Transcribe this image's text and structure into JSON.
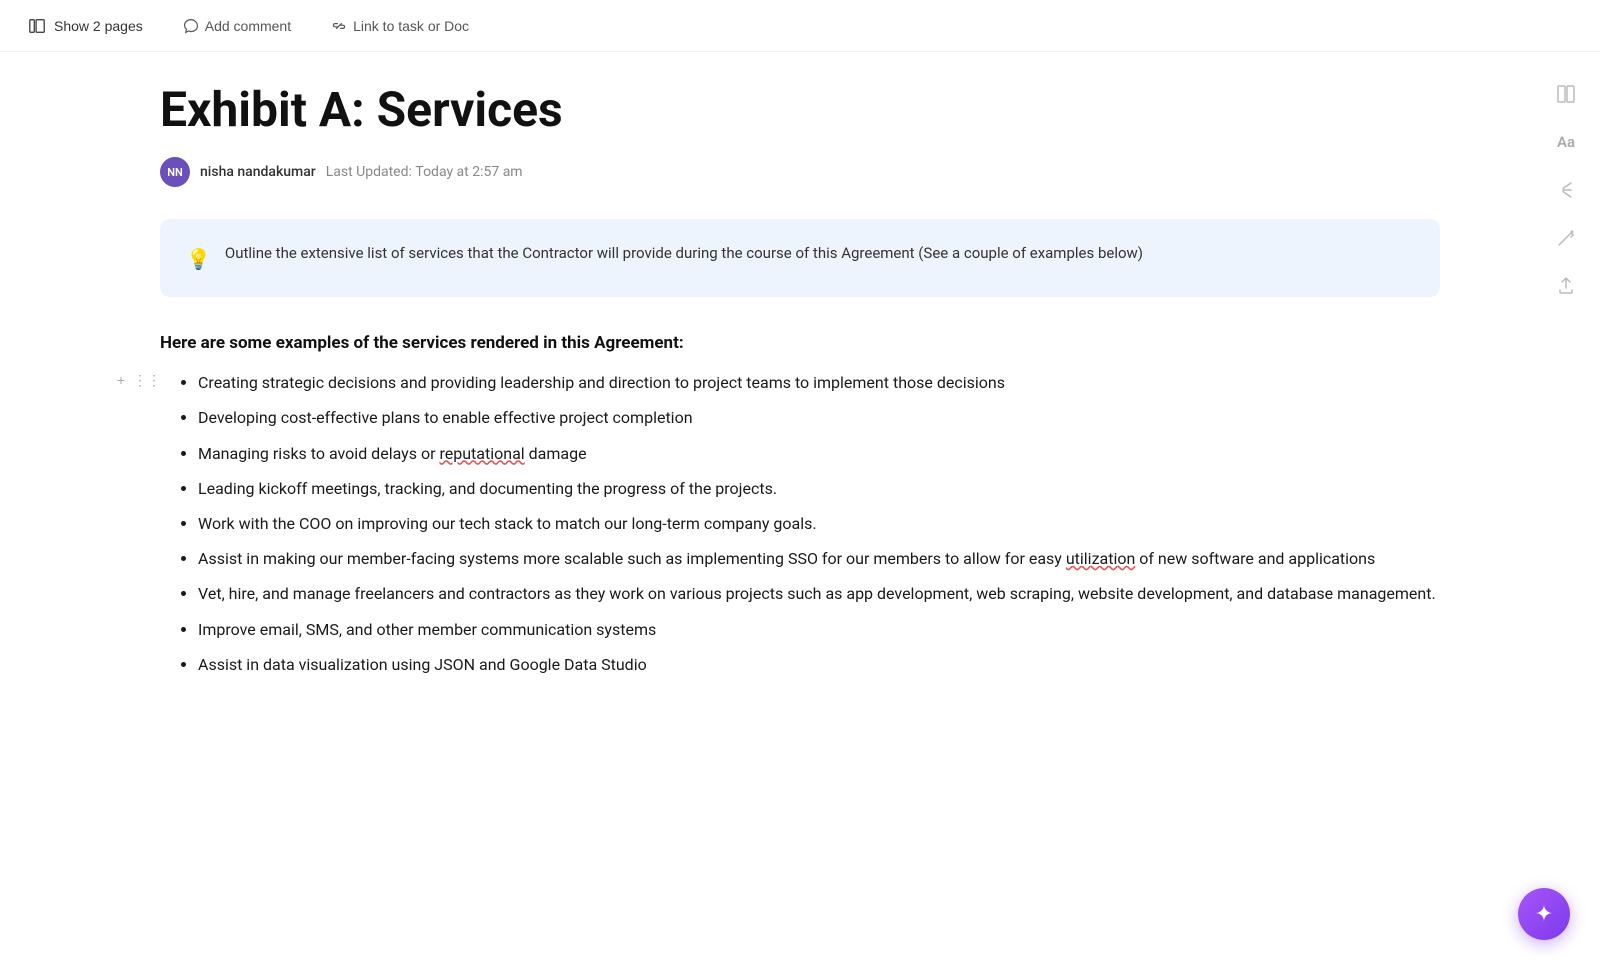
{
  "toolbar": {
    "show_pages_label": "Show 2 pages",
    "add_comment_label": "Add comment",
    "link_task_label": "Link to task or Doc"
  },
  "document": {
    "title": "Exhibit A: Services",
    "author": {
      "initials": "NN",
      "name": "nisha nandakumar",
      "last_updated_prefix": "Last Updated:",
      "last_updated_time": "Today at 2:57 am"
    },
    "hint": {
      "emoji": "💡",
      "text": "Outline the extensive list of services that the Contractor will provide during the course of this Agreement (See a couple of examples below)"
    },
    "section_heading": "Here are some examples of the services rendered in this Agreement:",
    "bullet_items": [
      {
        "text": "Creating strategic decisions and providing leadership and direction to project teams to implement those decisions",
        "has_underline": false
      },
      {
        "text": "Developing cost-effective plans to enable effective project completion",
        "has_underline": false
      },
      {
        "text": "Managing risks to avoid delays or reputational damage",
        "has_underline": true,
        "underline_word": "reputational"
      },
      {
        "text": "Leading kickoff meetings, tracking, and documenting the progress of the projects.",
        "has_underline": false
      },
      {
        "text": "Work with the COO on improving our tech stack to match our long-term company goals.",
        "has_underline": false
      },
      {
        "text": "Assist in making our member-facing systems more scalable such as implementing SSO for our members to allow for easy utilization of new software and applications",
        "has_underline": true,
        "underline_word": "utilization"
      },
      {
        "text": "Vet, hire, and manage freelancers and contractors as they work on various projects such as app development, web scraping, website development, and database management.",
        "has_underline": false
      },
      {
        "text": "Improve email, SMS, and other member communication systems",
        "has_underline": false
      },
      {
        "text": "Assist in data visualization using JSON and Google Data Studio",
        "has_underline": false,
        "partial": true
      }
    ]
  },
  "right_sidebar": {
    "icons": [
      {
        "name": "layout-icon",
        "symbol": "⊞"
      },
      {
        "name": "font-icon",
        "symbol": "Aa"
      },
      {
        "name": "share-icon",
        "symbol": "↗"
      },
      {
        "name": "edit-icon",
        "symbol": "✏"
      },
      {
        "name": "export-icon",
        "symbol": "↑"
      }
    ]
  },
  "fab": {
    "symbol": "✦"
  }
}
